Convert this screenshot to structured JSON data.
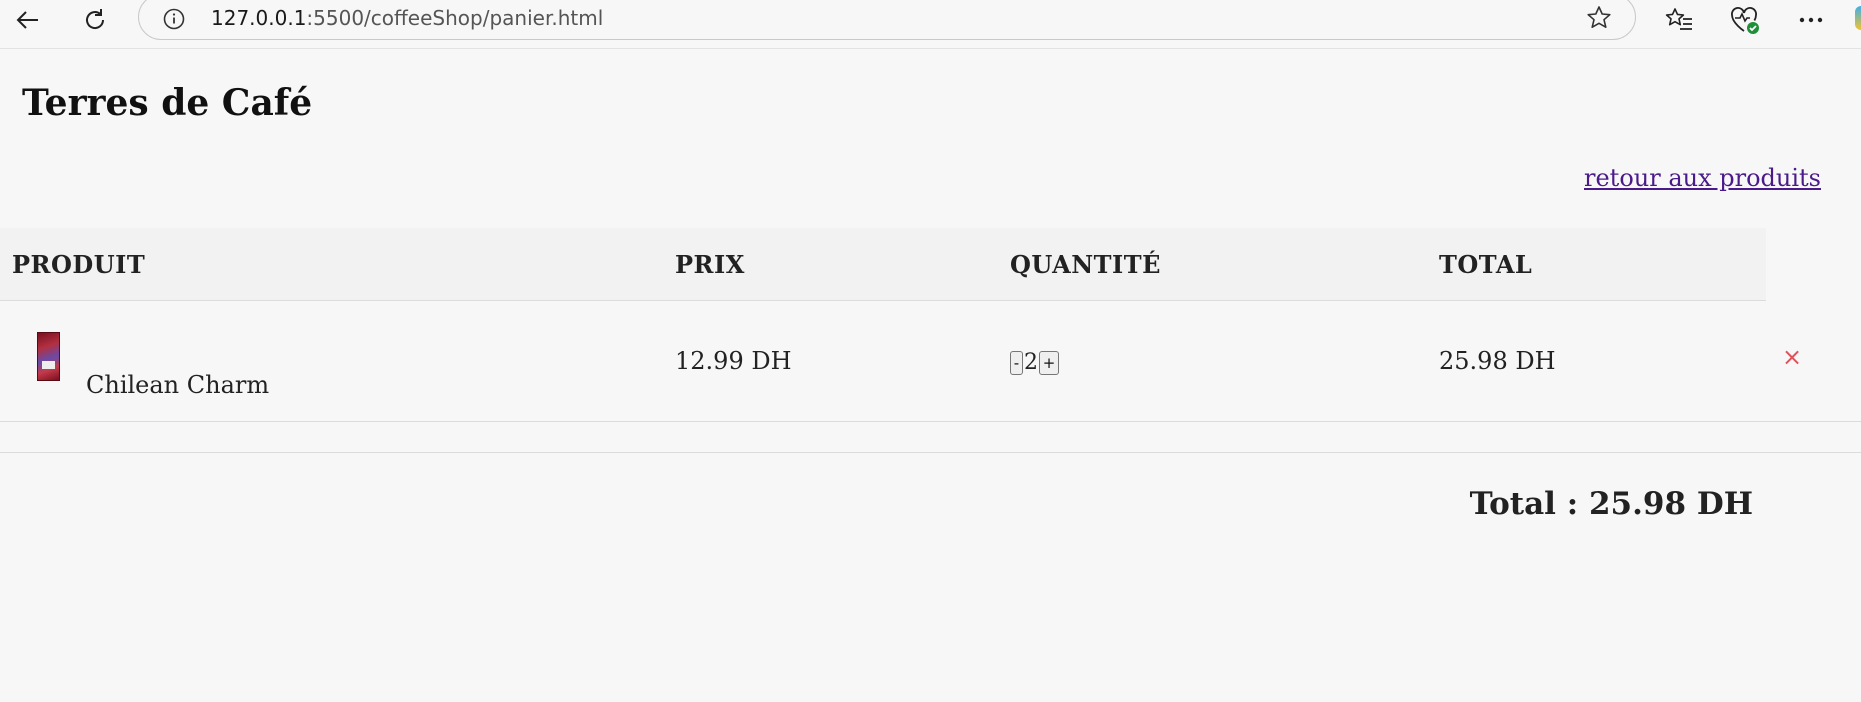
{
  "browser": {
    "url_host": "127.0.0.1",
    "url_rest": ":5500/coffeeShop/panier.html",
    "icons": [
      "back-arrow-icon",
      "reload-icon",
      "info-icon",
      "star-icon",
      "favorites-icon",
      "browser-essentials-icon",
      "more-icon"
    ]
  },
  "page": {
    "title": "Terres de Café",
    "back_link": "retour aux produits"
  },
  "cart": {
    "headers": {
      "product": "PRODUIT",
      "price": "PRIX",
      "quantity": "QUANTITÉ",
      "total": "TOTAL"
    },
    "items": [
      {
        "name": "Chilean Charm",
        "price": "12.99 DH",
        "quantity": "2",
        "minus_label": "-",
        "plus_label": "+",
        "total": "25.98 DH",
        "remove_label": "×"
      }
    ],
    "grand_total": "Total : 25.98 DH"
  },
  "colors": {
    "link": "#4b1a8a",
    "remove": "#e0525a",
    "background": "#f7f7f7"
  }
}
